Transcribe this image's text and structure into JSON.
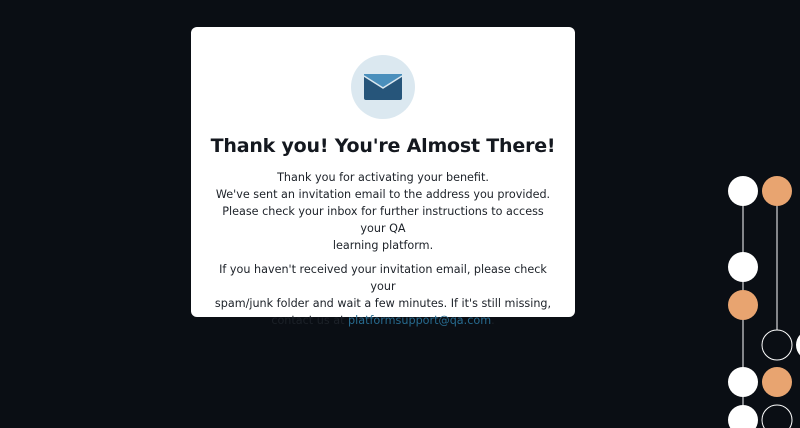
{
  "card": {
    "icon": "envelope-icon",
    "title": "Thank you! You're Almost There!",
    "para1": {
      "line1": "Thank you for activating your benefit.",
      "line2": "We've sent an invitation email to the address you provided.",
      "line3": "Please check your inbox for further instructions to access your QA",
      "line4": "learning platform."
    },
    "para2": {
      "line1": "If you haven't received your invitation email, please check your",
      "line2": "spam/junk folder and wait a few minutes. If it's still missing,",
      "line3_prefix": "contact us at ",
      "email": "platformsupport@qa.com",
      "line3_suffix": "."
    }
  },
  "colors": {
    "background": "#0a0e14",
    "card": "#ffffff",
    "accent": "#276a8e",
    "icon_bg": "#dbe8f0",
    "deco_orange": "#e8a470",
    "deco_white": "#ffffff"
  }
}
